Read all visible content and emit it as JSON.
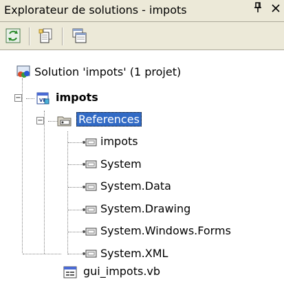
{
  "window": {
    "title": "Explorateur de solutions - impots",
    "pin_glyph": "#",
    "close_glyph": "×"
  },
  "toolbar": {
    "buttons": [
      {
        "name": "refresh-button",
        "icon": "refresh-icon"
      },
      {
        "name": "show-all-files-button",
        "icon": "show-all-files-icon"
      },
      {
        "name": "properties-button",
        "icon": "properties-icon"
      }
    ]
  },
  "tree": {
    "solution": {
      "label": "Solution 'impots' (1 projet)",
      "icon": "solution-icon"
    },
    "project": {
      "label": "impots",
      "icon": "vb-project-icon",
      "expanded": true
    },
    "references": {
      "label": "References",
      "icon": "references-folder-icon",
      "expanded": true,
      "selected": true,
      "items": [
        {
          "label": "impots"
        },
        {
          "label": "System"
        },
        {
          "label": "System.Data"
        },
        {
          "label": "System.Drawing"
        },
        {
          "label": "System.Windows.Forms"
        },
        {
          "label": "System.XML"
        }
      ]
    },
    "file": {
      "label": "gui_impots.vb",
      "icon": "vb-form-file-icon"
    }
  },
  "colors": {
    "chrome": "#ece9d8",
    "selection": "#316ac5"
  }
}
